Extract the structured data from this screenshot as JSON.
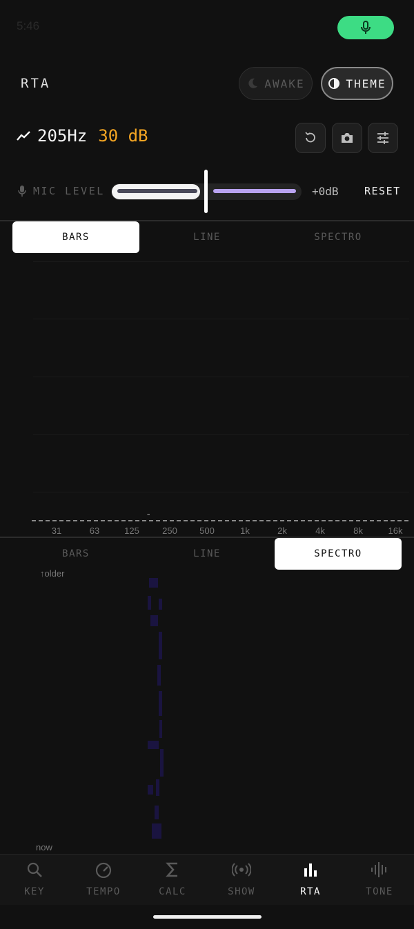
{
  "status": {
    "time": "5:46"
  },
  "header": {
    "title": "RTA",
    "awake_label": "AWAKE",
    "theme_label": "THEME"
  },
  "readout": {
    "frequency": "205Hz",
    "level": "30 dB"
  },
  "mic": {
    "label": "MIC LEVEL",
    "gain": "+0dB",
    "reset_label": "RESET",
    "slider_position": 0.5
  },
  "tabs": {
    "top": [
      {
        "label": "BARS"
      },
      {
        "label": "LINE"
      },
      {
        "label": "SPECTRO"
      }
    ],
    "top_active": "BARS",
    "bottom": [
      {
        "label": "BARS"
      },
      {
        "label": "LINE"
      },
      {
        "label": "SPECTRO"
      }
    ],
    "bottom_active": "SPECTRO"
  },
  "rta": {
    "peak_marker": "-",
    "freq_labels": [
      "31",
      "63",
      "125",
      "250",
      "500",
      "1k",
      "2k",
      "4k",
      "8k",
      "16k"
    ]
  },
  "spectro": {
    "top_label": "↑older",
    "bottom_label": "now"
  },
  "nav": {
    "items": [
      {
        "label": "KEY",
        "icon": "search-icon"
      },
      {
        "label": "TEMPO",
        "icon": "speedometer-icon"
      },
      {
        "label": "CALC",
        "icon": "sigma-icon"
      },
      {
        "label": "SHOW",
        "icon": "broadcast-icon"
      },
      {
        "label": "RTA",
        "icon": "bar-chart-icon"
      },
      {
        "label": "TONE",
        "icon": "waveform-icon"
      }
    ],
    "active": "RTA"
  },
  "colors": {
    "accent_green": "#3ddc84",
    "level_orange": "#f5a623",
    "slider_purple": "#b9a3f0"
  }
}
